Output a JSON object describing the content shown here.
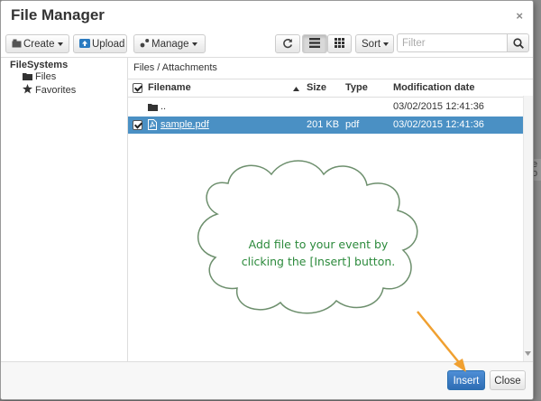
{
  "dialog": {
    "title": "File Manager",
    "close_glyph": "×"
  },
  "toolbar": {
    "create_label": "Create",
    "upload_label": "Upload",
    "manage_label": "Manage",
    "sort_label": "Sort",
    "filter_placeholder": "Filter",
    "icons": [
      "create-icon",
      "upload-icon",
      "manage-icon",
      "refresh-icon",
      "list-view-icon",
      "grid-view-icon",
      "search-icon"
    ]
  },
  "tree": {
    "root": "FileSystems",
    "items": [
      {
        "label": "Files",
        "icon": "folder-icon"
      },
      {
        "label": "Favorites",
        "icon": "star-icon"
      }
    ]
  },
  "main": {
    "path": "Files / Attachments",
    "columns": {
      "filename": "Filename",
      "size": "Size",
      "type": "Type",
      "modified": "Modification date"
    },
    "rows": [
      {
        "name": "..",
        "size": "",
        "type": "",
        "modified": "03/02/2015 12:41:36",
        "icon": "folder-icon",
        "selected": false
      },
      {
        "name": "sample.pdf",
        "size": "201 KB",
        "type": "pdf",
        "modified": "03/02/2015 12:41:36",
        "icon": "pdf-file-icon",
        "selected": true
      }
    ]
  },
  "callout": {
    "line1": "Add file to your event by",
    "line2": "clicking the [Insert] button."
  },
  "footer": {
    "insert_label": "Insert",
    "close_label": "Close"
  },
  "background": {
    "frag1": "e",
    "frag2": "o"
  },
  "colors": {
    "selection": "#4a90c4",
    "primary_button": "#2e6db4",
    "callout_text": "#2c8a3c",
    "arrow": "#f0a030"
  }
}
